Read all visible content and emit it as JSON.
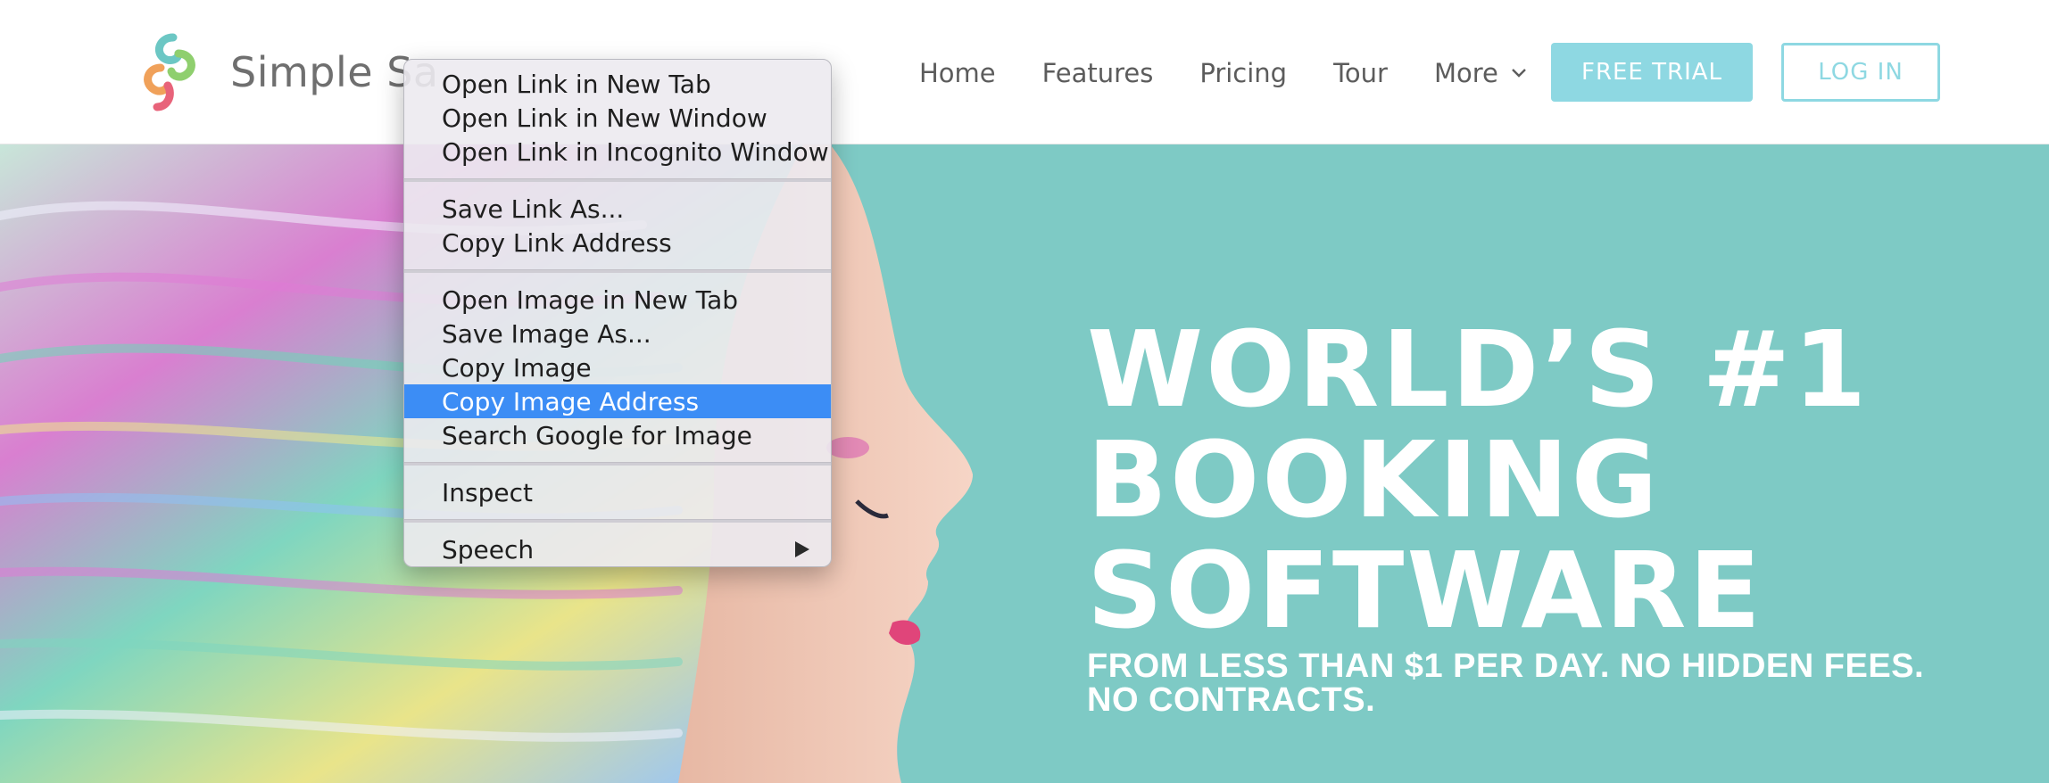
{
  "brand": {
    "name": "Simple Sa"
  },
  "nav": {
    "items": [
      {
        "label": "Home"
      },
      {
        "label": "Features"
      },
      {
        "label": "Pricing"
      },
      {
        "label": "Tour"
      },
      {
        "label": "More"
      }
    ]
  },
  "buttons": {
    "trial": "FREE TRIAL",
    "login": "LOG IN"
  },
  "hero": {
    "title_lines": [
      "WORLD’S #1",
      "BOOKING",
      "SOFTWARE"
    ],
    "subtitle_lines": [
      "FROM LESS THAN $1 PER DAY. NO HIDDEN FEES.",
      "NO CONTRACTS."
    ]
  },
  "context_menu": {
    "group1": [
      "Open Link in New Tab",
      "Open Link in New Window",
      "Open Link in Incognito Window"
    ],
    "group2": [
      "Save Link As...",
      "Copy Link Address"
    ],
    "group3": [
      "Open Image in New Tab",
      "Save Image As...",
      "Copy Image",
      "Copy Image Address",
      "Search Google for Image"
    ],
    "group4": [
      "Inspect"
    ],
    "group5": [
      "Speech"
    ],
    "highlighted": "Copy Image Address"
  },
  "colors": {
    "accent": "#8ed8e2",
    "hero_bg": "#7ecac5",
    "menu_highlight": "#3c8df5"
  },
  "icons": {
    "brand_logo": "brand-logo-icon",
    "more_chevron": "chevron-down-icon",
    "submenu": "submenu-arrow-icon"
  }
}
